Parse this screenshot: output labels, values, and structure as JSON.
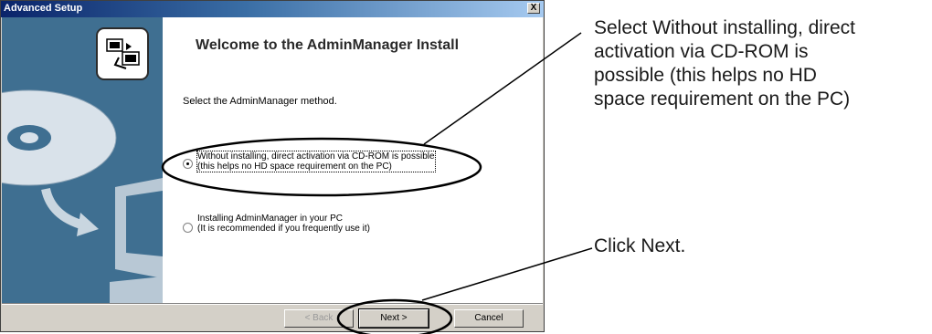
{
  "window": {
    "title": "Advanced Setup",
    "close_glyph": "X"
  },
  "content": {
    "heading": "Welcome to the AdminManager Install",
    "instruction": "Select the AdminManager method."
  },
  "options": [
    {
      "line1": "Without installing, direct activation via CD-ROM is possible",
      "line2": "(this helps no HD space requirement on the PC)",
      "selected": true
    },
    {
      "line1": "Installing AdminManager in your PC",
      "line2": "(It is recommended if you frequently use it)",
      "selected": false
    }
  ],
  "buttons": {
    "back": "< Back",
    "next": "Next >",
    "cancel": "Cancel"
  },
  "callouts": {
    "option": [
      "Select Without installing, direct",
      "activation via CD-ROM is",
      "possible (this helps no HD",
      "space requirement on the PC)"
    ],
    "next": "Click Next."
  },
  "icons": {
    "setup": "computer-setup-icon",
    "disc": "cd-disc-icon",
    "monitor": "monitor-icon",
    "arrow": "curved-arrow-icon"
  }
}
